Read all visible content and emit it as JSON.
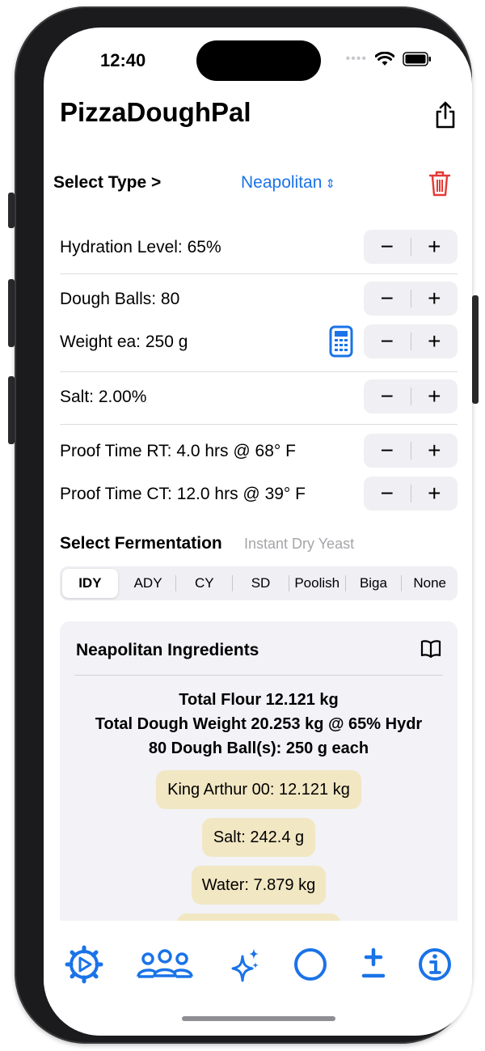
{
  "status_bar": {
    "time": "12:40"
  },
  "app": {
    "title": "PizzaDoughPal"
  },
  "type_selector": {
    "label": "Select Type >",
    "value": "Neapolitan"
  },
  "controls": {
    "hydration": "Hydration Level: 65%",
    "dough_balls": "Dough Balls: 80",
    "weight_each": "Weight ea: 250 g",
    "salt": "Salt: 2.00%",
    "proof_rt": "Proof Time RT: 4.0 hrs @ 68° F",
    "proof_ct": "Proof Time CT: 12.0 hrs @ 39° F",
    "minus": "−",
    "plus": "+"
  },
  "fermentation": {
    "label": "Select Fermentation",
    "value": "Instant Dry Yeast",
    "options": [
      "IDY",
      "ADY",
      "CY",
      "SD",
      "Poolish",
      "Biga",
      "None"
    ],
    "selected": "IDY"
  },
  "ingredients": {
    "title": "Neapolitan Ingredients",
    "total_flour": "Total Flour 12.121 kg",
    "total_dough": "Total Dough Weight 20.253 kg @ 65% Hydr",
    "balls": "80 Dough Ball(s): 250 g each",
    "items": [
      "King Arthur 00: 12.121 kg",
      "Salt: 242.4 g",
      "Water: 7.879 kg"
    ]
  },
  "tabbar": {
    "icons": [
      "gear-play-icon",
      "people-icon",
      "sparkles-icon",
      "circle-icon",
      "plus-minus-icon",
      "info-icon"
    ]
  },
  "colors": {
    "accent": "#1a73e8",
    "destructive": "#e53935",
    "pill": "#f2e7c3"
  }
}
